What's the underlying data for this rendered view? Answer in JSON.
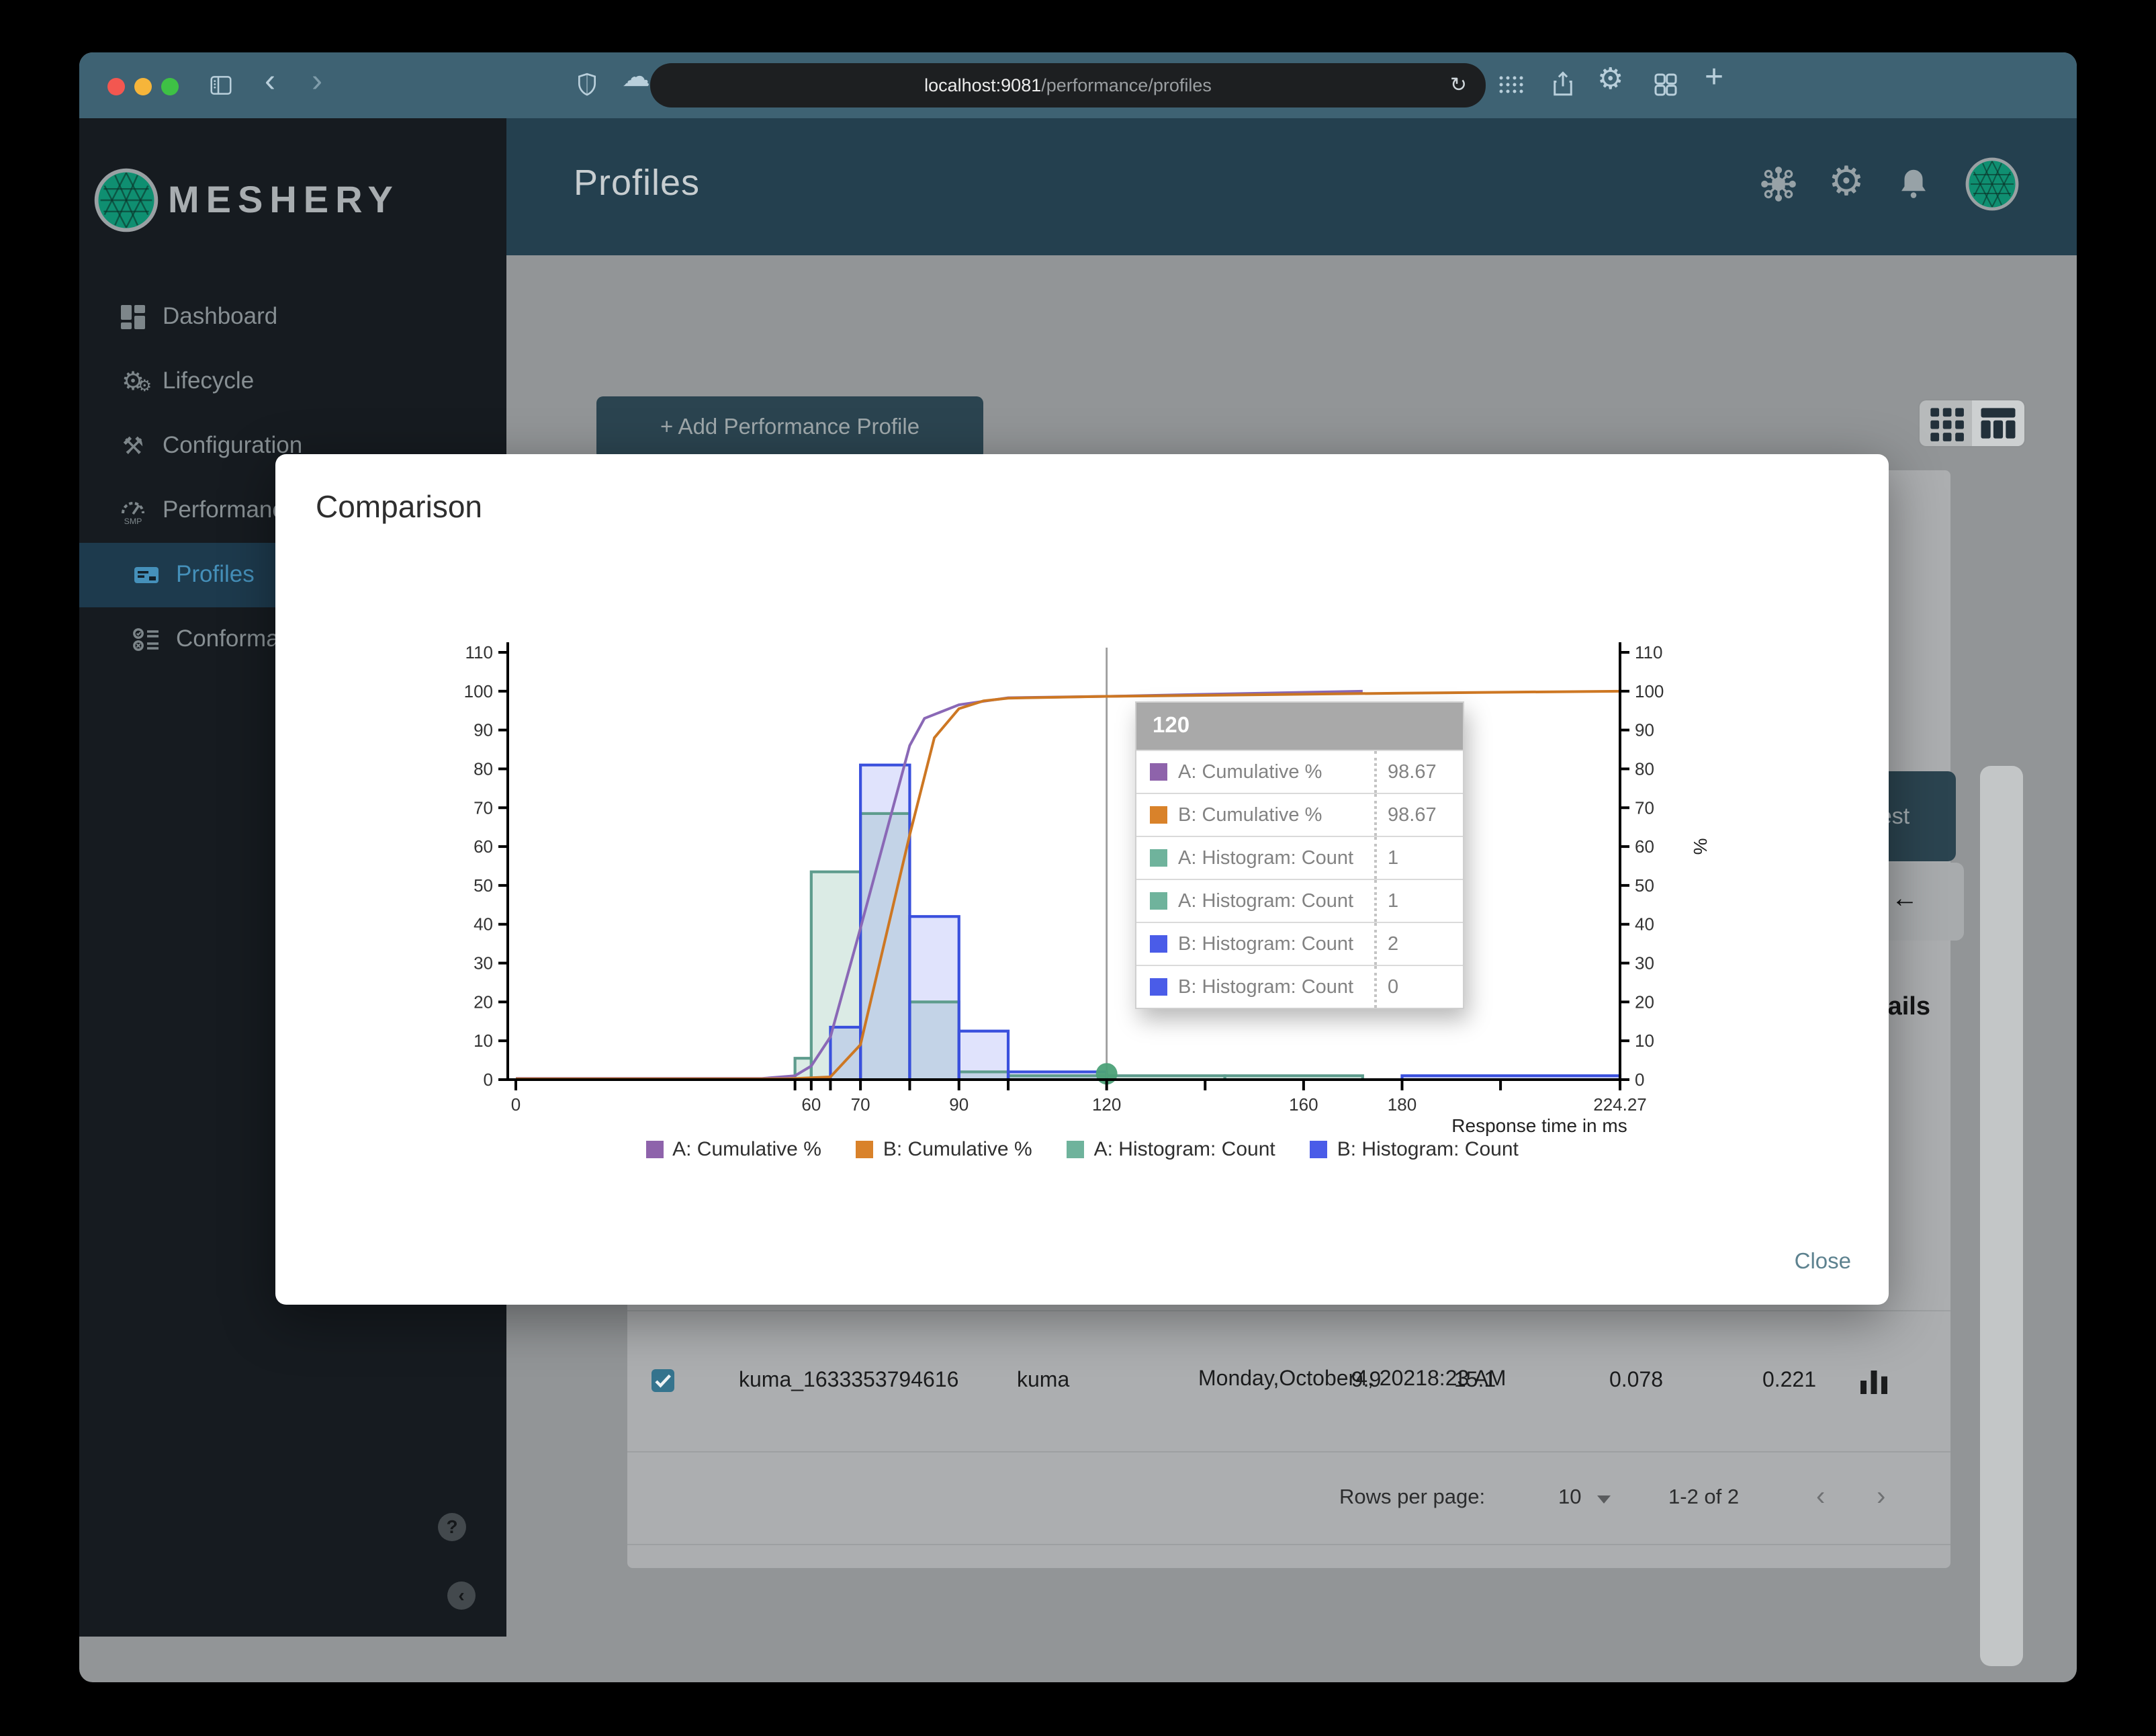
{
  "browser": {
    "url_host": "localhost:9081",
    "url_path": "/performance/profiles",
    "reload_icon": "↻",
    "back_icon": "‹",
    "forward_icon": "›",
    "cloud_icon": "☁",
    "plus_icon": "+",
    "gear_icon": "⚙"
  },
  "brand": {
    "name": "MESHERY"
  },
  "header": {
    "title": "Profiles",
    "gear_icon": "⚙"
  },
  "sidebar": {
    "items": [
      {
        "label": "Dashboard",
        "icon": "dashboard-icon",
        "indent": false,
        "active": false
      },
      {
        "label": "Lifecycle",
        "icon": "lifecycle-icon",
        "indent": false,
        "active": false
      },
      {
        "label": "Configuration",
        "icon": "configuration-icon",
        "indent": false,
        "active": false
      },
      {
        "label": "Performance",
        "icon": "performance-icon",
        "indent": false,
        "active": false
      },
      {
        "label": "Profiles",
        "icon": "profiles-icon",
        "indent": true,
        "active": true
      },
      {
        "label": "Conformance",
        "icon": "conformance-icon",
        "indent": true,
        "active": false
      }
    ],
    "help_icon": "?",
    "collapse_icon": "‹"
  },
  "page": {
    "add_profile_button": "+ Add Performance Profile",
    "test_button": "Test",
    "back_arrow": "←",
    "details_heading": "Details"
  },
  "table": {
    "row": {
      "checked": true,
      "name": "kuma_1633353794616",
      "mesh": "kuma",
      "date_lines": [
        "Monday,",
        "October",
        "4, 2021",
        "8:23 AM"
      ],
      "values": [
        "9.9",
        "15.1",
        "0.078",
        "0.221"
      ]
    }
  },
  "pagination": {
    "label": "Rows per page:",
    "value": "10",
    "range": "1-2 of 2",
    "prev_icon": "‹",
    "next_icon": "›"
  },
  "modal": {
    "title": "Comparison",
    "close_label": "Close"
  },
  "tooltip": {
    "header": "120",
    "rows": [
      {
        "color": "#8e63ab",
        "label": "A: Cumulative %",
        "value": "98.67"
      },
      {
        "color": "#d9822a",
        "label": "B: Cumulative %",
        "value": "98.67"
      },
      {
        "color": "#6fb39c",
        "label": "A: Histogram: Count",
        "value": "1"
      },
      {
        "color": "#6fb39c",
        "label": "A: Histogram: Count",
        "value": "1"
      },
      {
        "color": "#4a5ce8",
        "label": "B: Histogram: Count",
        "value": "2"
      },
      {
        "color": "#4a5ce8",
        "label": "B: Histogram: Count",
        "value": "0"
      }
    ]
  },
  "chart_data": {
    "type": "histogram+cumulative-lines",
    "title": "",
    "xlabel": "Response time in ms",
    "ylabel_right": "%",
    "xlim": [
      0,
      224.27
    ],
    "ylim": [
      0,
      110
    ],
    "grid": false,
    "legend_position": "bottom",
    "y_ticks": [
      0,
      10,
      20,
      30,
      40,
      50,
      60,
      70,
      80,
      90,
      100,
      110
    ],
    "x_ticks": [
      {
        "v": 0,
        "label": "0"
      },
      {
        "v": 56.7,
        "label": ""
      },
      {
        "v": 60,
        "label": "60"
      },
      {
        "v": 63.9,
        "label": ""
      },
      {
        "v": 70,
        "label": "70"
      },
      {
        "v": 80,
        "label": ""
      },
      {
        "v": 90,
        "label": "90"
      },
      {
        "v": 100,
        "label": ""
      },
      {
        "v": 120,
        "label": "120"
      },
      {
        "v": 140,
        "label": ""
      },
      {
        "v": 160,
        "label": "160"
      },
      {
        "v": 180,
        "label": "180"
      },
      {
        "v": 200,
        "label": ""
      },
      {
        "v": 224.27,
        "label": "224.27"
      }
    ],
    "series": [
      {
        "name": "A: Cumulative %",
        "type": "line",
        "color": "#8a68b6",
        "points": [
          [
            0,
            0.3
          ],
          [
            50,
            0.3
          ],
          [
            56.7,
            1
          ],
          [
            60,
            3.5
          ],
          [
            63.9,
            11
          ],
          [
            70,
            39
          ],
          [
            80,
            86
          ],
          [
            83,
            93
          ],
          [
            90,
            96.5
          ],
          [
            100,
            98.3
          ],
          [
            120,
            98.67
          ],
          [
            144,
            99.3
          ],
          [
            172,
            100
          ]
        ]
      },
      {
        "name": "B: Cumulative %",
        "type": "line",
        "color": "#cd7723",
        "points": [
          [
            0,
            0.2
          ],
          [
            55,
            0.2
          ],
          [
            63.9,
            0.7
          ],
          [
            70,
            9
          ],
          [
            80,
            63
          ],
          [
            85,
            88
          ],
          [
            90,
            95.5
          ],
          [
            95,
            97.5
          ],
          [
            100,
            98.2
          ],
          [
            120,
            98.67
          ],
          [
            180,
            99.5
          ],
          [
            224.27,
            100
          ]
        ]
      },
      {
        "name": "A: Histogram: Count",
        "type": "histogram",
        "color": "#5e9c8d",
        "fill": "rgba(126,182,160,0.28)",
        "bins": [
          [
            56.7,
            60,
            5.5
          ],
          [
            60,
            70,
            53.5
          ],
          [
            70,
            80,
            68.5
          ],
          [
            80,
            90,
            20
          ],
          [
            90,
            100,
            2
          ],
          [
            100,
            120,
            1
          ],
          [
            120,
            144,
            1
          ],
          [
            144,
            172,
            1
          ]
        ]
      },
      {
        "name": "B: Histogram: Count",
        "type": "histogram",
        "color": "#3a50dd",
        "fill": "rgba(99,113,240,0.20)",
        "bins": [
          [
            63.9,
            70,
            13.5
          ],
          [
            70,
            80,
            81
          ],
          [
            80,
            90,
            42
          ],
          [
            90,
            100,
            12.5
          ],
          [
            100,
            120,
            2
          ],
          [
            180,
            224.27,
            1
          ]
        ]
      }
    ],
    "legend": [
      {
        "label": "A: Cumulative %",
        "color": "#8e63ab"
      },
      {
        "label": "B: Cumulative %",
        "color": "#d9822a"
      },
      {
        "label": "A: Histogram: Count",
        "color": "#6fb39c"
      },
      {
        "label": "B: Histogram: Count",
        "color": "#4a5ce8"
      }
    ],
    "crosshair_x": 120,
    "marker": {
      "x": 120,
      "y": 1.5,
      "color": "#4ca178"
    }
  }
}
